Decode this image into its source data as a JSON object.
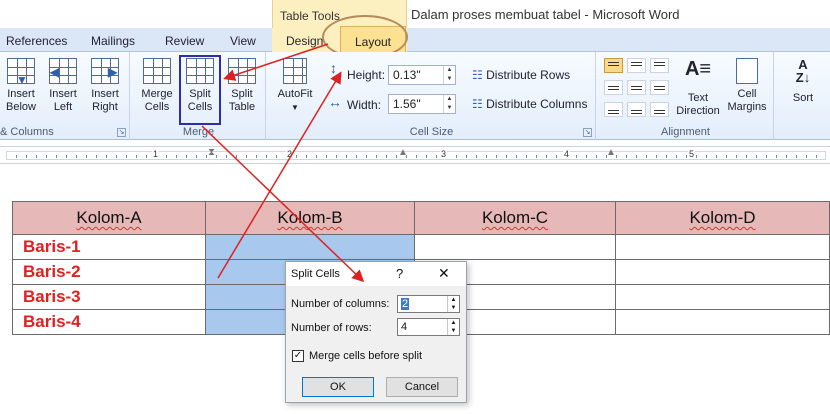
{
  "window": {
    "contextual_group": "Table Tools",
    "title": "Dalam proses membuat tabel - Microsoft Word"
  },
  "tabs": {
    "references": "References",
    "mailings": "Mailings",
    "review": "Review",
    "view": "View",
    "design": "Design",
    "layout": "Layout"
  },
  "ribbon": {
    "rows_columns": {
      "insert_below": [
        "Insert",
        "Below"
      ],
      "insert_left": [
        "Insert",
        "Left"
      ],
      "insert_right": [
        "Insert",
        "Right"
      ],
      "group_label": "& Columns"
    },
    "merge": {
      "merge_cells": [
        "Merge",
        "Cells"
      ],
      "split_cells": [
        "Split",
        "Cells"
      ],
      "split_table": [
        "Split",
        "Table"
      ],
      "group_label": "Merge"
    },
    "cell_size": {
      "autofit": "AutoFit",
      "height_label": "Height:",
      "height_value": "0.13\"",
      "width_label": "Width:",
      "width_value": "1.56\"",
      "distribute_rows": "Distribute Rows",
      "distribute_columns": "Distribute Columns",
      "group_label": "Cell Size"
    },
    "alignment": {
      "text_direction": [
        "Text",
        "Direction"
      ],
      "cell_margins": [
        "Cell",
        "Margins"
      ],
      "group_label": "Alignment"
    },
    "data": {
      "sort": "Sort"
    }
  },
  "ruler": {
    "numbers": [
      "1",
      "2",
      "3",
      "4",
      "5"
    ]
  },
  "table": {
    "headers": [
      "Kolom-A",
      "Kolom-B",
      "Kolom-C",
      "Kolom-D"
    ],
    "rows": [
      "Baris-1",
      "Baris-2",
      "Baris-3",
      "Baris-4"
    ]
  },
  "dialog": {
    "title": "Split Cells",
    "help": "?",
    "close": "✕",
    "columns_label": "Number of columns:",
    "columns_value": "2",
    "rows_label": "Number of rows:",
    "rows_value": "4",
    "merge_label": "Merge cells before split",
    "merge_checked": true,
    "ok": "OK",
    "cancel": "Cancel"
  },
  "colors": {
    "header_fill": "#e6b8b7",
    "row_label": "#e02020",
    "selection": "#a9c8ee",
    "annotation": "#e02020"
  }
}
